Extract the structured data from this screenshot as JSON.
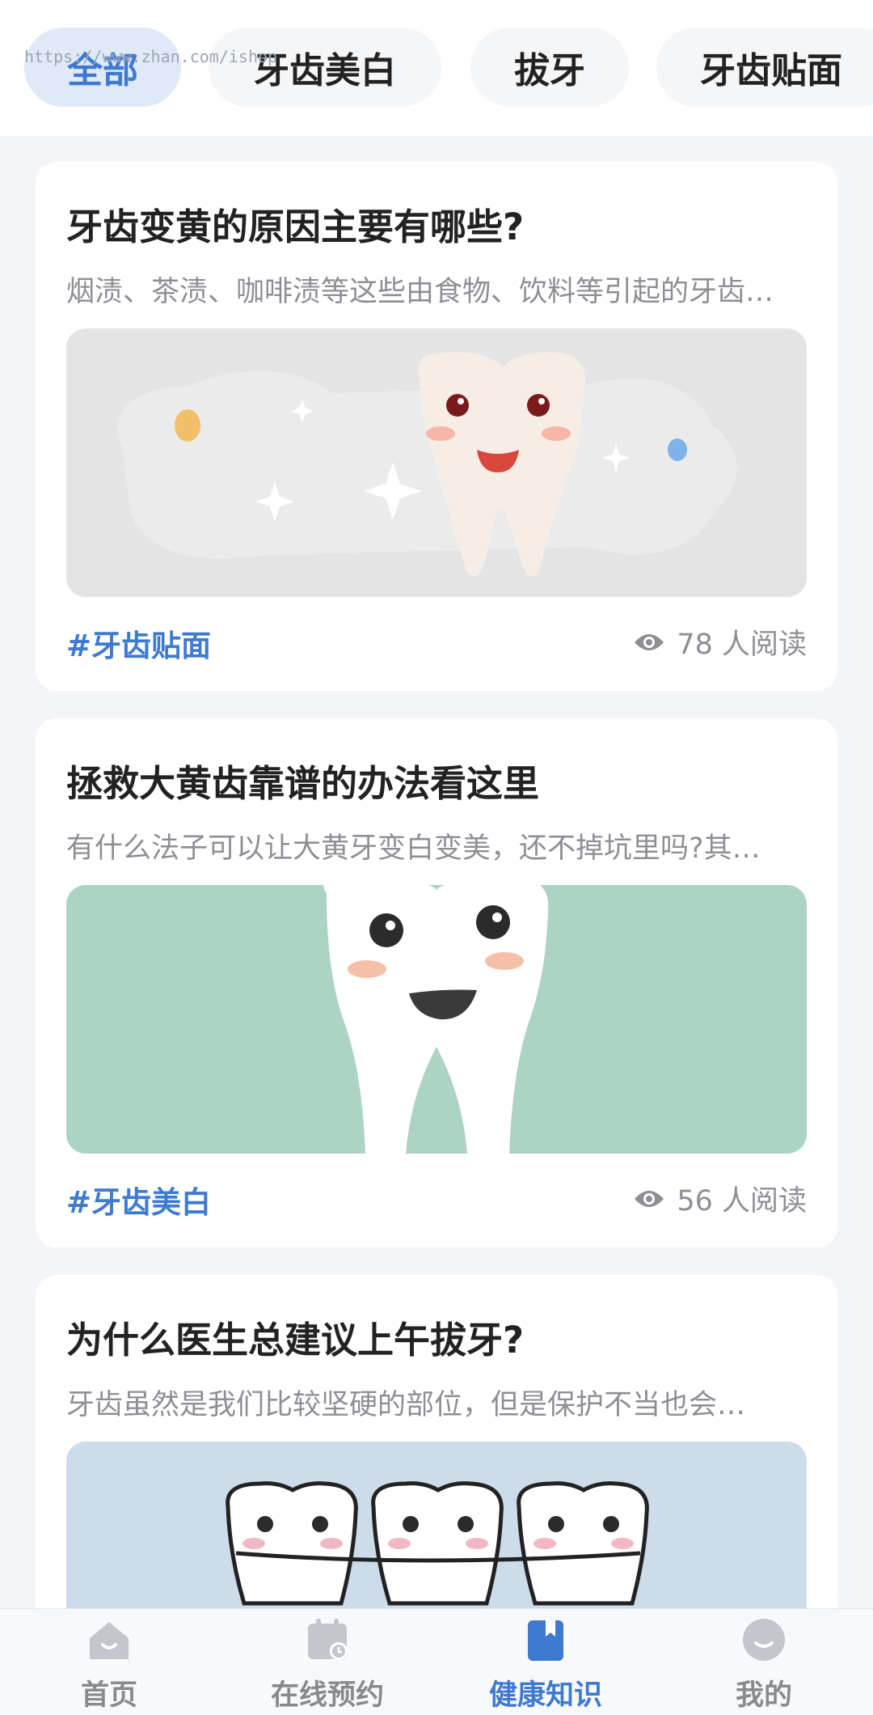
{
  "tabs": [
    {
      "label": "全部",
      "active": true
    },
    {
      "label": "牙齿美白",
      "active": false
    },
    {
      "label": "拔牙",
      "active": false
    },
    {
      "label": "牙齿贴面",
      "active": false
    }
  ],
  "watermark": "https://www.zhan.com/ishop",
  "articles": [
    {
      "title": "牙齿变黄的原因主要有哪些?",
      "summary": "烟渍、茶渍、咖啡渍等这些由食物、饮料等引起的牙齿…",
      "tag": "#牙齿贴面",
      "reads": "78 人阅读"
    },
    {
      "title": "拯救大黄齿靠谱的办法看这里",
      "summary": "有什么法子可以让大黄牙变白变美，还不掉坑里吗?其…",
      "tag": "#牙齿美白",
      "reads": "56 人阅读"
    },
    {
      "title": "为什么医生总建议上午拔牙?",
      "summary": "牙齿虽然是我们比较坚硬的部位，但是保护不当也会…"
    }
  ],
  "nav": [
    {
      "label": "首页",
      "icon": "home-icon"
    },
    {
      "label": "在线预约",
      "icon": "calendar-icon"
    },
    {
      "label": "健康知识",
      "icon": "book-icon",
      "active": true
    },
    {
      "label": "我的",
      "icon": "profile-icon"
    }
  ],
  "colors": {
    "accent": "#3f7ad1",
    "tab_active_bg": "#dfe9f8",
    "card_2_image_bg": "#acd3c4",
    "card_3_image_bg": "#cddcea"
  }
}
